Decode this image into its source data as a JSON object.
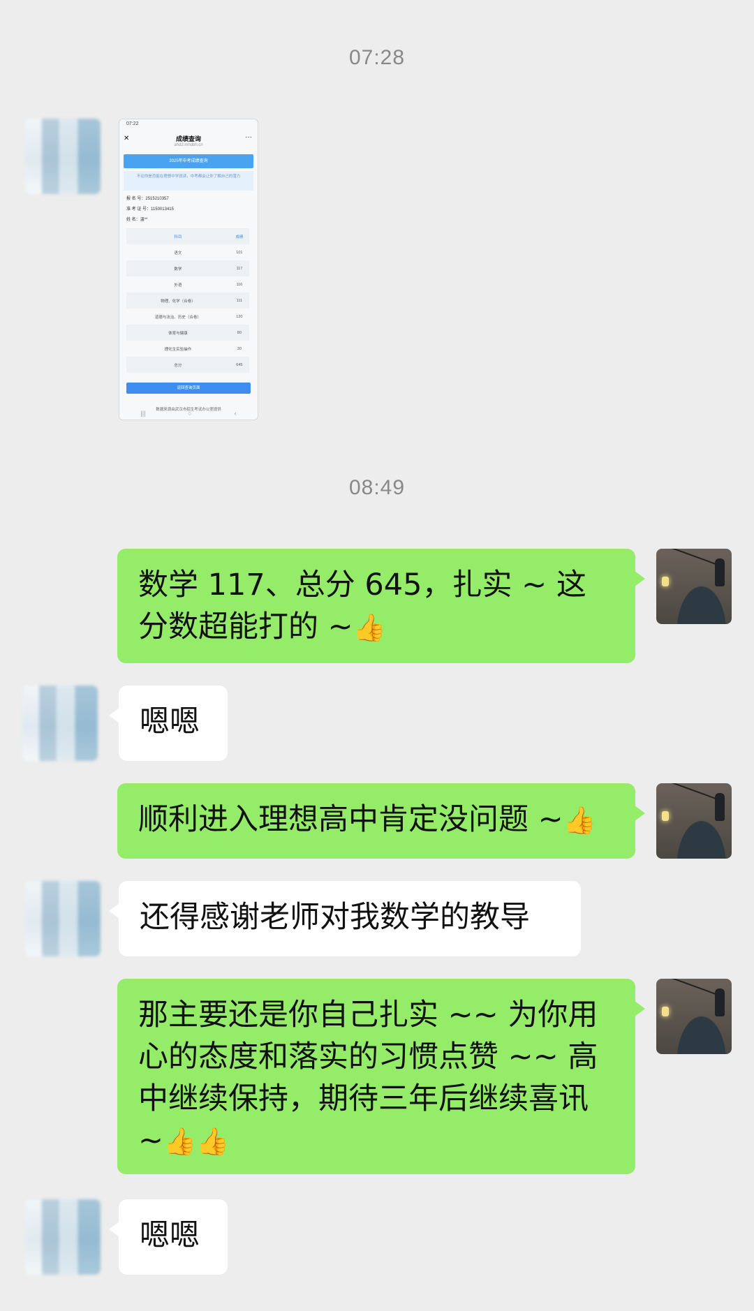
{
  "timestamps": [
    "07:28",
    "08:49"
  ],
  "screenshot": {
    "status_time": "07:22",
    "title": "成绩查询",
    "url": "ahd2.mhdbh.cn",
    "banner": "2025年中考成绩查询",
    "tip": "不论你是否能在理想中学就读，中考都会让你了解自己的潜力",
    "info": [
      {
        "label": "报  名  号",
        "value": "2515210357"
      },
      {
        "label": "准  考  证  号",
        "value": "1150013415"
      },
      {
        "label": "姓  名",
        "value": "温**"
      }
    ],
    "table_header": [
      "科目",
      "成绩"
    ],
    "rows": [
      [
        "语文",
        "101"
      ],
      [
        "数学",
        "117"
      ],
      [
        "外语",
        "116"
      ],
      [
        "物理、化学（合卷）",
        "111"
      ],
      [
        "道德与法治、历史（合卷）",
        "120"
      ],
      [
        "体育与健康",
        "80"
      ],
      [
        "理化生实验操作",
        "30"
      ],
      [
        "总分",
        "645"
      ]
    ],
    "button": "返回查询页面",
    "footer": "数据来源由武汉市招生考试办公室提供",
    "nav": [
      "|||",
      "○",
      "‹"
    ]
  },
  "messages": [
    {
      "text": "数学 117、总分 645，扎实 ~ 这分数超能打的 ~",
      "emoji": "👍"
    },
    {
      "text": "嗯嗯"
    },
    {
      "text": "顺利进入理想高中肯定没问题 ~",
      "emoji": "👍"
    },
    {
      "text": "还得感谢老师对我数学的教导"
    },
    {
      "text": "那主要还是你自己扎实 ~~ 为你用心的态度和落实的习惯点赞 ~~ 高中继续保持，期待三年后继续喜讯 ~",
      "emoji": "👍👍"
    },
    {
      "text": "嗯嗯"
    }
  ]
}
